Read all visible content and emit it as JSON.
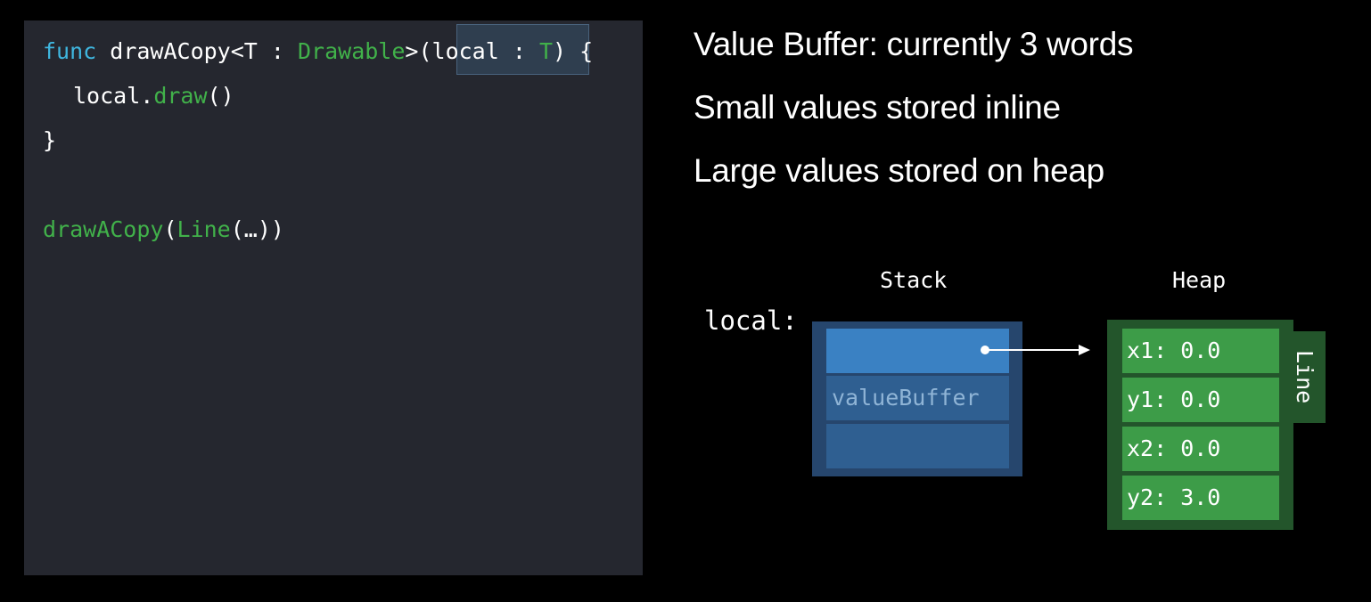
{
  "code": {
    "line1": {
      "kw_func": "func",
      "name": " drawACopy<T : ",
      "protocol": "Drawable",
      "open": ">(",
      "param": "local : ",
      "param_type": "T",
      "close": ") {"
    },
    "line2": {
      "receiver": "local.",
      "method": "draw",
      "parens": "()"
    },
    "line3": "}",
    "line5": {
      "call": "drawACopy",
      "open": "(",
      "type": "Line",
      "args": "(…))"
    }
  },
  "bullets": [
    "Value Buffer: currently 3 words",
    "Small values stored inline",
    "Large values stored on heap"
  ],
  "diagram": {
    "stack_label": "Stack",
    "heap_label": "Heap",
    "local_label": "local:",
    "stack_cells": [
      "",
      "valueBuffer",
      ""
    ],
    "heap_type_label": "Line",
    "heap_cells": [
      "x1: 0.0",
      "y1: 0.0",
      "x2: 0.0",
      "y2: 3.0"
    ],
    "colors": {
      "stack_frame": "#26466d",
      "stack_cell_active": "#3a81c3",
      "stack_cell": "#2f5f91",
      "heap_frame": "#23552b",
      "heap_cell": "#3d9c48"
    }
  }
}
